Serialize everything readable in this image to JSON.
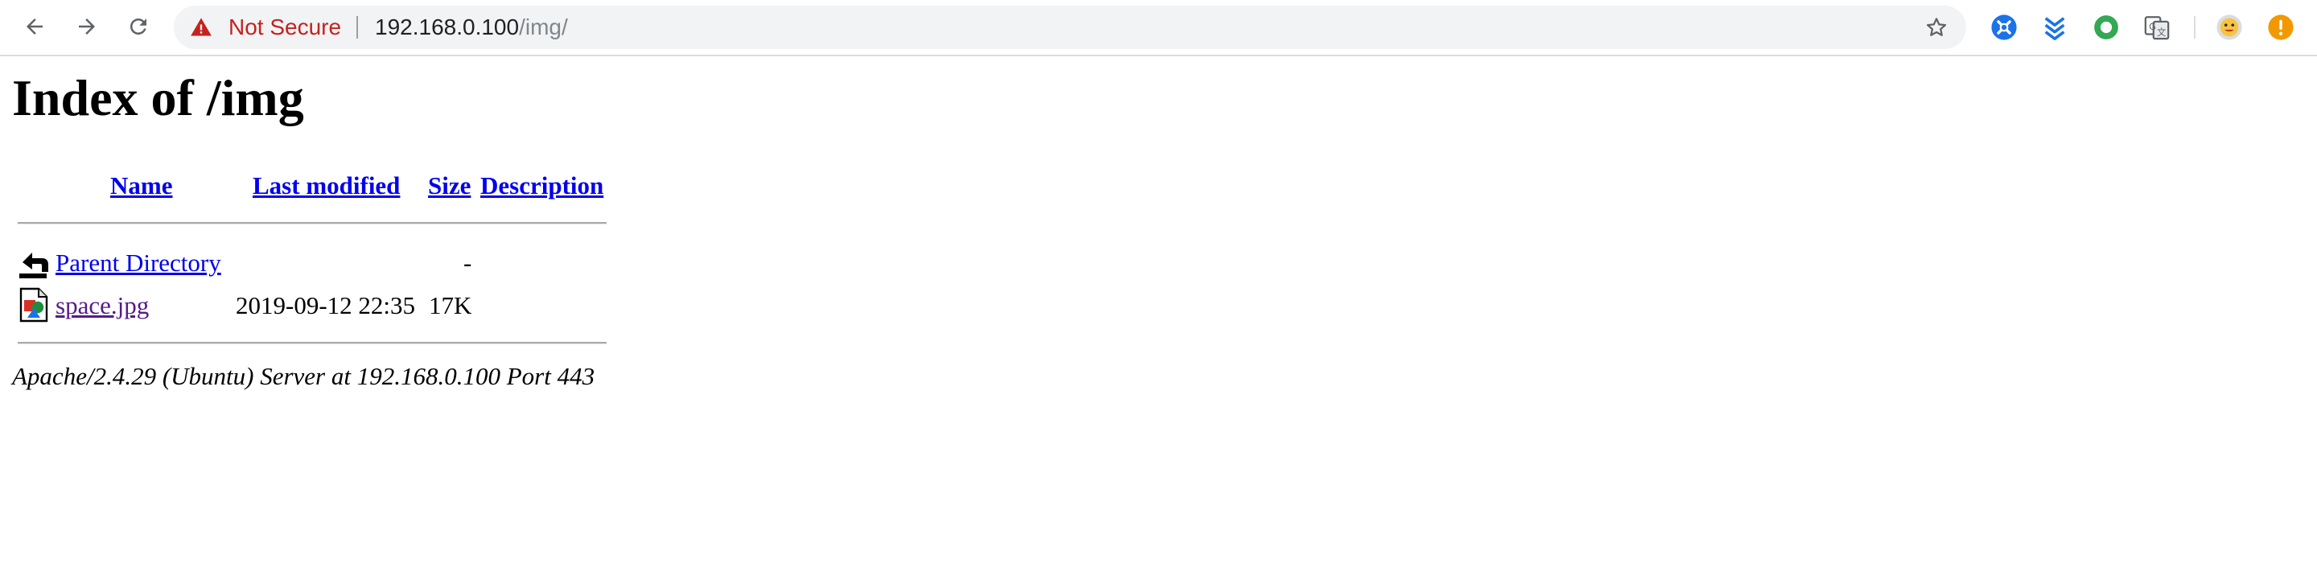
{
  "browser": {
    "security_label": "Not Secure",
    "url_host": "192.168.0.100",
    "url_path": "/img/",
    "nav": {
      "back_icon": "arrow-left-icon",
      "forward_icon": "arrow-right-icon",
      "reload_icon": "reload-icon"
    },
    "extensions": [
      "blue-puzzle-icon",
      "chevrons-icon",
      "green-ring-icon",
      "translate-icon"
    ],
    "profile_icon": "avatar-icon",
    "alert_icon": "update-alert-icon"
  },
  "page": {
    "title": "Index of /img",
    "columns": {
      "name": "Name",
      "last_modified": "Last modified",
      "size": "Size",
      "description": "Description"
    },
    "rows": [
      {
        "icon": "back-folder-icon",
        "name": "Parent Directory",
        "last_modified": "",
        "size": "-",
        "description": "",
        "visited": false
      },
      {
        "icon": "image-file-icon",
        "name": "space.jpg",
        "last_modified": "2019-09-12 22:35",
        "size": "17K",
        "description": "",
        "visited": true
      }
    ],
    "footer": "Apache/2.4.29 (Ubuntu) Server at 192.168.0.100 Port 443"
  },
  "colors": {
    "link": "#0000ee",
    "visited_link": "#551a8b",
    "not_secure": "#c5221f",
    "omnibox_bg": "#f1f3f4"
  }
}
